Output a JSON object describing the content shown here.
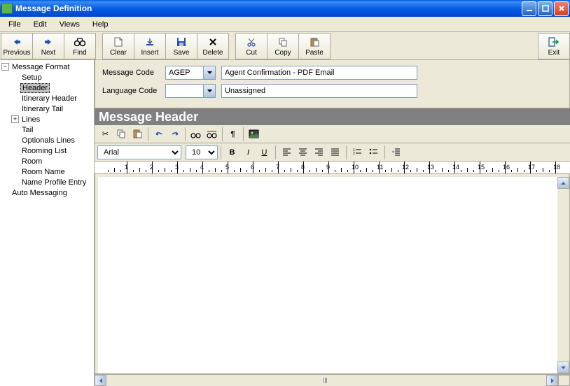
{
  "window": {
    "title": "Message Definition"
  },
  "menu": {
    "file": "File",
    "edit": "Edit",
    "views": "Views",
    "help": "Help"
  },
  "toolbar": {
    "previous": "Previous",
    "next": "Next",
    "find": "Find",
    "clear": "Clear",
    "insert": "Insert",
    "save": "Save",
    "delete": "Delete",
    "cut": "Cut",
    "copy": "Copy",
    "paste": "Paste",
    "exit": "Exit"
  },
  "tree": {
    "root": "Message Format",
    "items": {
      "setup": "Setup",
      "header": "Header",
      "itinerary_header": "Itinerary Header",
      "itinerary_tail": "Itinerary Tail",
      "lines": "Lines",
      "tail": "Tail",
      "optionals_lines": "Optionals Lines",
      "rooming_list": "Rooming List",
      "room": "Room",
      "room_name": "Room Name",
      "name_profile_entry": "Name Profile Entry"
    },
    "auto_messaging": "Auto Messaging"
  },
  "form": {
    "message_code_label": "Message Code",
    "message_code_value": "AGEP",
    "message_code_desc": "Agent Confirmation - PDF Email",
    "language_code_label": "Language Code",
    "language_code_value": "",
    "language_code_desc": "Unassigned"
  },
  "section": {
    "header": "Message Header"
  },
  "editor": {
    "font": "Arial",
    "size": "10"
  },
  "ruler": {
    "marks": [
      1,
      2,
      3,
      4,
      5,
      6,
      7,
      8,
      9,
      10,
      11,
      12,
      13,
      14,
      15,
      16,
      17,
      18
    ]
  }
}
